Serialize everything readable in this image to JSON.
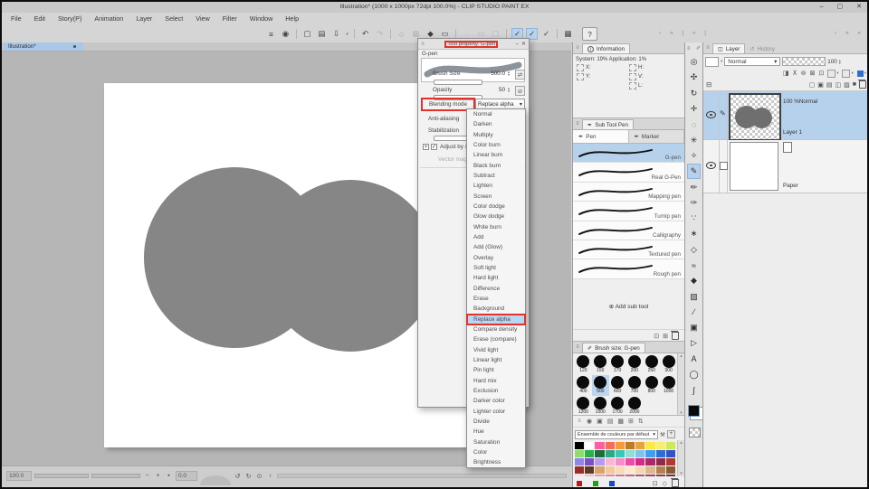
{
  "window": {
    "title": "Illustration* (1000 x 1000px 72dpi 100.0%) - CLIP STUDIO PAINT EX",
    "minimize": "–",
    "maximize": "▢",
    "close": "✕"
  },
  "icons": {
    "handle": "≡",
    "chevron": "▾",
    "up": "▴",
    "down": "▾",
    "left": "‹",
    "rotate_left": "↺",
    "rotate_right": "↻",
    "reset": "⊙",
    "minus": "−",
    "plus": "+",
    "fit": "▪",
    "info": "i",
    "add_circle": "⊕",
    "pen_nib": "✒",
    "pencil": "✏",
    "brush": "✐",
    "history": "↺",
    "collapse": "⊟",
    "wrench": "⚒",
    "plusbox": "+",
    "check": "✓",
    "dot": "●",
    "slash": "⊘",
    "swap": "⇄",
    "arrows_mid": "› » | » |",
    "arrows_right": "› » «"
  },
  "menu": [
    "File",
    "Edit",
    "Story(P)",
    "Animation",
    "Layer",
    "Select",
    "View",
    "Filter",
    "Window",
    "Help"
  ],
  "command_bar": [
    {
      "glyph": "≡"
    },
    {
      "glyph": "◉"
    },
    {
      "cls": "sep"
    },
    {
      "glyph": "▢"
    },
    {
      "glyph": "▤"
    },
    {
      "glyph": "⇩"
    },
    {
      "glyph": "▾",
      "cls": "mini"
    },
    {
      "cls": "sep"
    },
    {
      "glyph": "↶"
    },
    {
      "glyph": "↷",
      "cls": "gray"
    },
    {
      "cls": "sep"
    },
    {
      "glyph": "◌"
    },
    {
      "glyph": "▦",
      "cls": "gray"
    },
    {
      "glyph": "◆"
    },
    {
      "glyph": "▭"
    },
    {
      "cls": "sep"
    },
    {
      "glyph": "◌",
      "cls": "gray"
    },
    {
      "glyph": "▭",
      "cls": "gray"
    },
    {
      "glyph": "▢",
      "cls": "gray"
    },
    {
      "cls": "sep"
    },
    {
      "glyph": "✓",
      "cls": "blue"
    },
    {
      "glyph": "✓",
      "cls": "blue"
    },
    {
      "glyph": "✓"
    },
    {
      "cls": "sep"
    },
    {
      "glyph": "▦"
    },
    {
      "glyph": "?",
      "cls": "help"
    }
  ],
  "doc_tab": "Illustration*",
  "tool_property": {
    "title": "Tool property: G-pen",
    "tool_name": "G-pen",
    "brush_size_label": "Brush Size",
    "brush_size_value": "500.0",
    "opacity_label": "Opacity",
    "opacity_value": "50",
    "blending_label": "Blending mode",
    "blending_value": "Replace alpha",
    "anti_aliasing_label": "Anti-aliasing",
    "stabilization_label": "Stabilization",
    "adjust_label": "Adjust by s",
    "vector_label": "Vector mag"
  },
  "blend_modes": [
    {
      "label": "Normal"
    },
    {
      "label": "Darken"
    },
    {
      "label": "Multiply"
    },
    {
      "label": "Color burn"
    },
    {
      "label": "Linear burn"
    },
    {
      "label": "Black burn"
    },
    {
      "label": "Subtract"
    },
    {
      "label": "Lighten"
    },
    {
      "label": "Screen"
    },
    {
      "label": "Color dodge"
    },
    {
      "label": "Glow dodge"
    },
    {
      "label": "White burn"
    },
    {
      "label": "Add"
    },
    {
      "label": "Add (Glow)"
    },
    {
      "label": "Overlay"
    },
    {
      "label": "Soft light"
    },
    {
      "label": "Hard light"
    },
    {
      "label": "Difference"
    },
    {
      "label": "Erase"
    },
    {
      "label": "Background"
    },
    {
      "label": "Replace alpha",
      "cls": "selected red-outline"
    },
    {
      "label": "Compare density"
    },
    {
      "label": "Erase (compare)"
    },
    {
      "label": "Vivid light"
    },
    {
      "label": "Linear light"
    },
    {
      "label": "Pin light"
    },
    {
      "label": "Hard mix"
    },
    {
      "label": "Exclusion"
    },
    {
      "label": "Darker color"
    },
    {
      "label": "Lighter color"
    },
    {
      "label": "Divide"
    },
    {
      "label": "Hue"
    },
    {
      "label": "Saturation"
    },
    {
      "label": "Color"
    },
    {
      "label": "Brightness"
    }
  ],
  "info_panel": {
    "tab": "Information",
    "usage": "System: 19% Application: 1%",
    "left_fields": [
      "X:",
      "Y:"
    ],
    "right_fields": [
      "H:",
      "V:",
      "L:"
    ]
  },
  "sub_tool": {
    "tab": "Sub Tool Pen",
    "group_tabs": [
      {
        "label": "Pen",
        "cls": "active"
      },
      {
        "label": "Marker"
      }
    ],
    "items": [
      {
        "label": "G-pen",
        "cls": "selected"
      },
      {
        "label": "Real G-Pen"
      },
      {
        "label": "Mapping pen"
      },
      {
        "label": "Turnip pen"
      },
      {
        "label": "Calligraphy"
      },
      {
        "label": "Textured pen"
      },
      {
        "label": "Rough pen"
      }
    ],
    "add_label": "Add sub tool",
    "bottom_icons": [
      {
        "g": "⊡"
      },
      {
        "g": "⊞"
      }
    ]
  },
  "brush_sizes": {
    "tab": "Brush size: G-pen",
    "items": [
      {
        "label": "120"
      },
      {
        "label": "150"
      },
      {
        "label": "170"
      },
      {
        "label": "200"
      },
      {
        "label": "250"
      },
      {
        "label": "300"
      },
      {
        "label": "400"
      },
      {
        "label": "500",
        "cls": "selected"
      },
      {
        "label": "600"
      },
      {
        "label": "700"
      },
      {
        "label": "800"
      },
      {
        "label": "1000"
      },
      {
        "label": "1200"
      },
      {
        "label": "1500"
      },
      {
        "label": "1700"
      },
      {
        "label": "2000"
      }
    ]
  },
  "color_set": {
    "name": "Ensemble de couleurs par défaut",
    "toolbar_icons": [
      {
        "g": "◉"
      },
      {
        "g": "▣"
      },
      {
        "g": "▤"
      },
      {
        "g": "▦"
      },
      {
        "g": "⊞"
      },
      {
        "g": "⇅"
      }
    ],
    "swatches": [
      "#000000",
      "#ffffff",
      "#ff5fa0",
      "#f66b5a",
      "#f79a38",
      "#bf7a28",
      "#e8a33c",
      "#ffe93e",
      "#f8f06a",
      "#cfe957",
      "#8ede6a",
      "#2fae4e",
      "#1a6e3c",
      "#2aa984",
      "#37c9b6",
      "#8fe0d4",
      "#7cc4ef",
      "#3e9ff0",
      "#2a6fd4",
      "#2f55c9",
      "#8f86e8",
      "#7a4fc9",
      "#b79af2",
      "#f7b6d8",
      "#f78ccb",
      "#ee4ba8",
      "#d42a8a",
      "#a82a68",
      "#93284c",
      "#b03a30",
      "#962e28",
      "#5c3a28",
      "#d9a46a",
      "#f6c79a",
      "#fbd9b8",
      "#fde7cd",
      "#f3d6b4",
      "#e0b68c",
      "#b5804e",
      "#8a5a32",
      "#f9dce4",
      "#f4b8c8",
      "#e89aae",
      "#d9889e",
      "#c9788e",
      "#b9687e",
      "#a9586e",
      "#99485e",
      "#89384e",
      "#79283e"
    ],
    "history": [
      "#c01818",
      "#1ea01e",
      "#1848c8"
    ],
    "bottom_icons": [
      {
        "g": "⊡"
      },
      {
        "g": "◇"
      }
    ]
  },
  "tool_strip": [
    {
      "name": "zoom-tool",
      "glyph": "◎"
    },
    {
      "name": "hand-tool",
      "glyph": "✣"
    },
    {
      "name": "rotate-tool",
      "glyph": "↻"
    },
    {
      "name": "move-tool",
      "glyph": "✛"
    },
    {
      "name": "selection-tool",
      "glyph": "◌"
    },
    {
      "name": "auto-select-tool",
      "glyph": "✳"
    },
    {
      "name": "eyedropper-tool",
      "glyph": "✧"
    },
    {
      "name": "pen-tool",
      "glyph": "✎",
      "cls": "selected"
    },
    {
      "name": "pencil-tool",
      "glyph": "✏"
    },
    {
      "name": "brush-tool",
      "glyph": "✑"
    },
    {
      "name": "airbrush-tool",
      "glyph": "∵"
    },
    {
      "name": "decoration-tool",
      "glyph": "∗"
    },
    {
      "name": "eraser-tool",
      "glyph": "◇"
    },
    {
      "name": "blend-tool",
      "glyph": "≈"
    },
    {
      "name": "fill-tool",
      "glyph": "◆"
    },
    {
      "name": "gradient-tool",
      "glyph": "▨"
    },
    {
      "name": "figure-tool",
      "glyph": "∕"
    },
    {
      "name": "frame-tool",
      "glyph": "▣"
    },
    {
      "name": "polyline-tool",
      "glyph": "▷"
    },
    {
      "name": "text-tool",
      "glyph": "A"
    },
    {
      "name": "balloon-tool",
      "glyph": "◯"
    },
    {
      "name": "correction-tool",
      "glyph": "∫"
    }
  ],
  "layer_panel": {
    "tab_layer": "Layer",
    "tab_history": "History",
    "blend": "Normal",
    "opacity": "100",
    "row2_icons": [
      {
        "g": "◨"
      },
      {
        "g": "⊼"
      },
      {
        "g": "⊚"
      },
      {
        "g": "⊠"
      },
      {
        "g": "⊡"
      }
    ],
    "row3_icons": [
      {
        "g": "▢"
      },
      {
        "g": "▣"
      },
      {
        "g": "▤"
      },
      {
        "g": "◫"
      },
      {
        "g": "▨"
      },
      {
        "g": "■"
      }
    ],
    "layers": [
      {
        "info": "100 %Normal",
        "name": "Layer 1"
      },
      {
        "name": "Paper"
      }
    ]
  },
  "status_bar": {
    "zoom": "100.0",
    "rotation": "0.0"
  }
}
